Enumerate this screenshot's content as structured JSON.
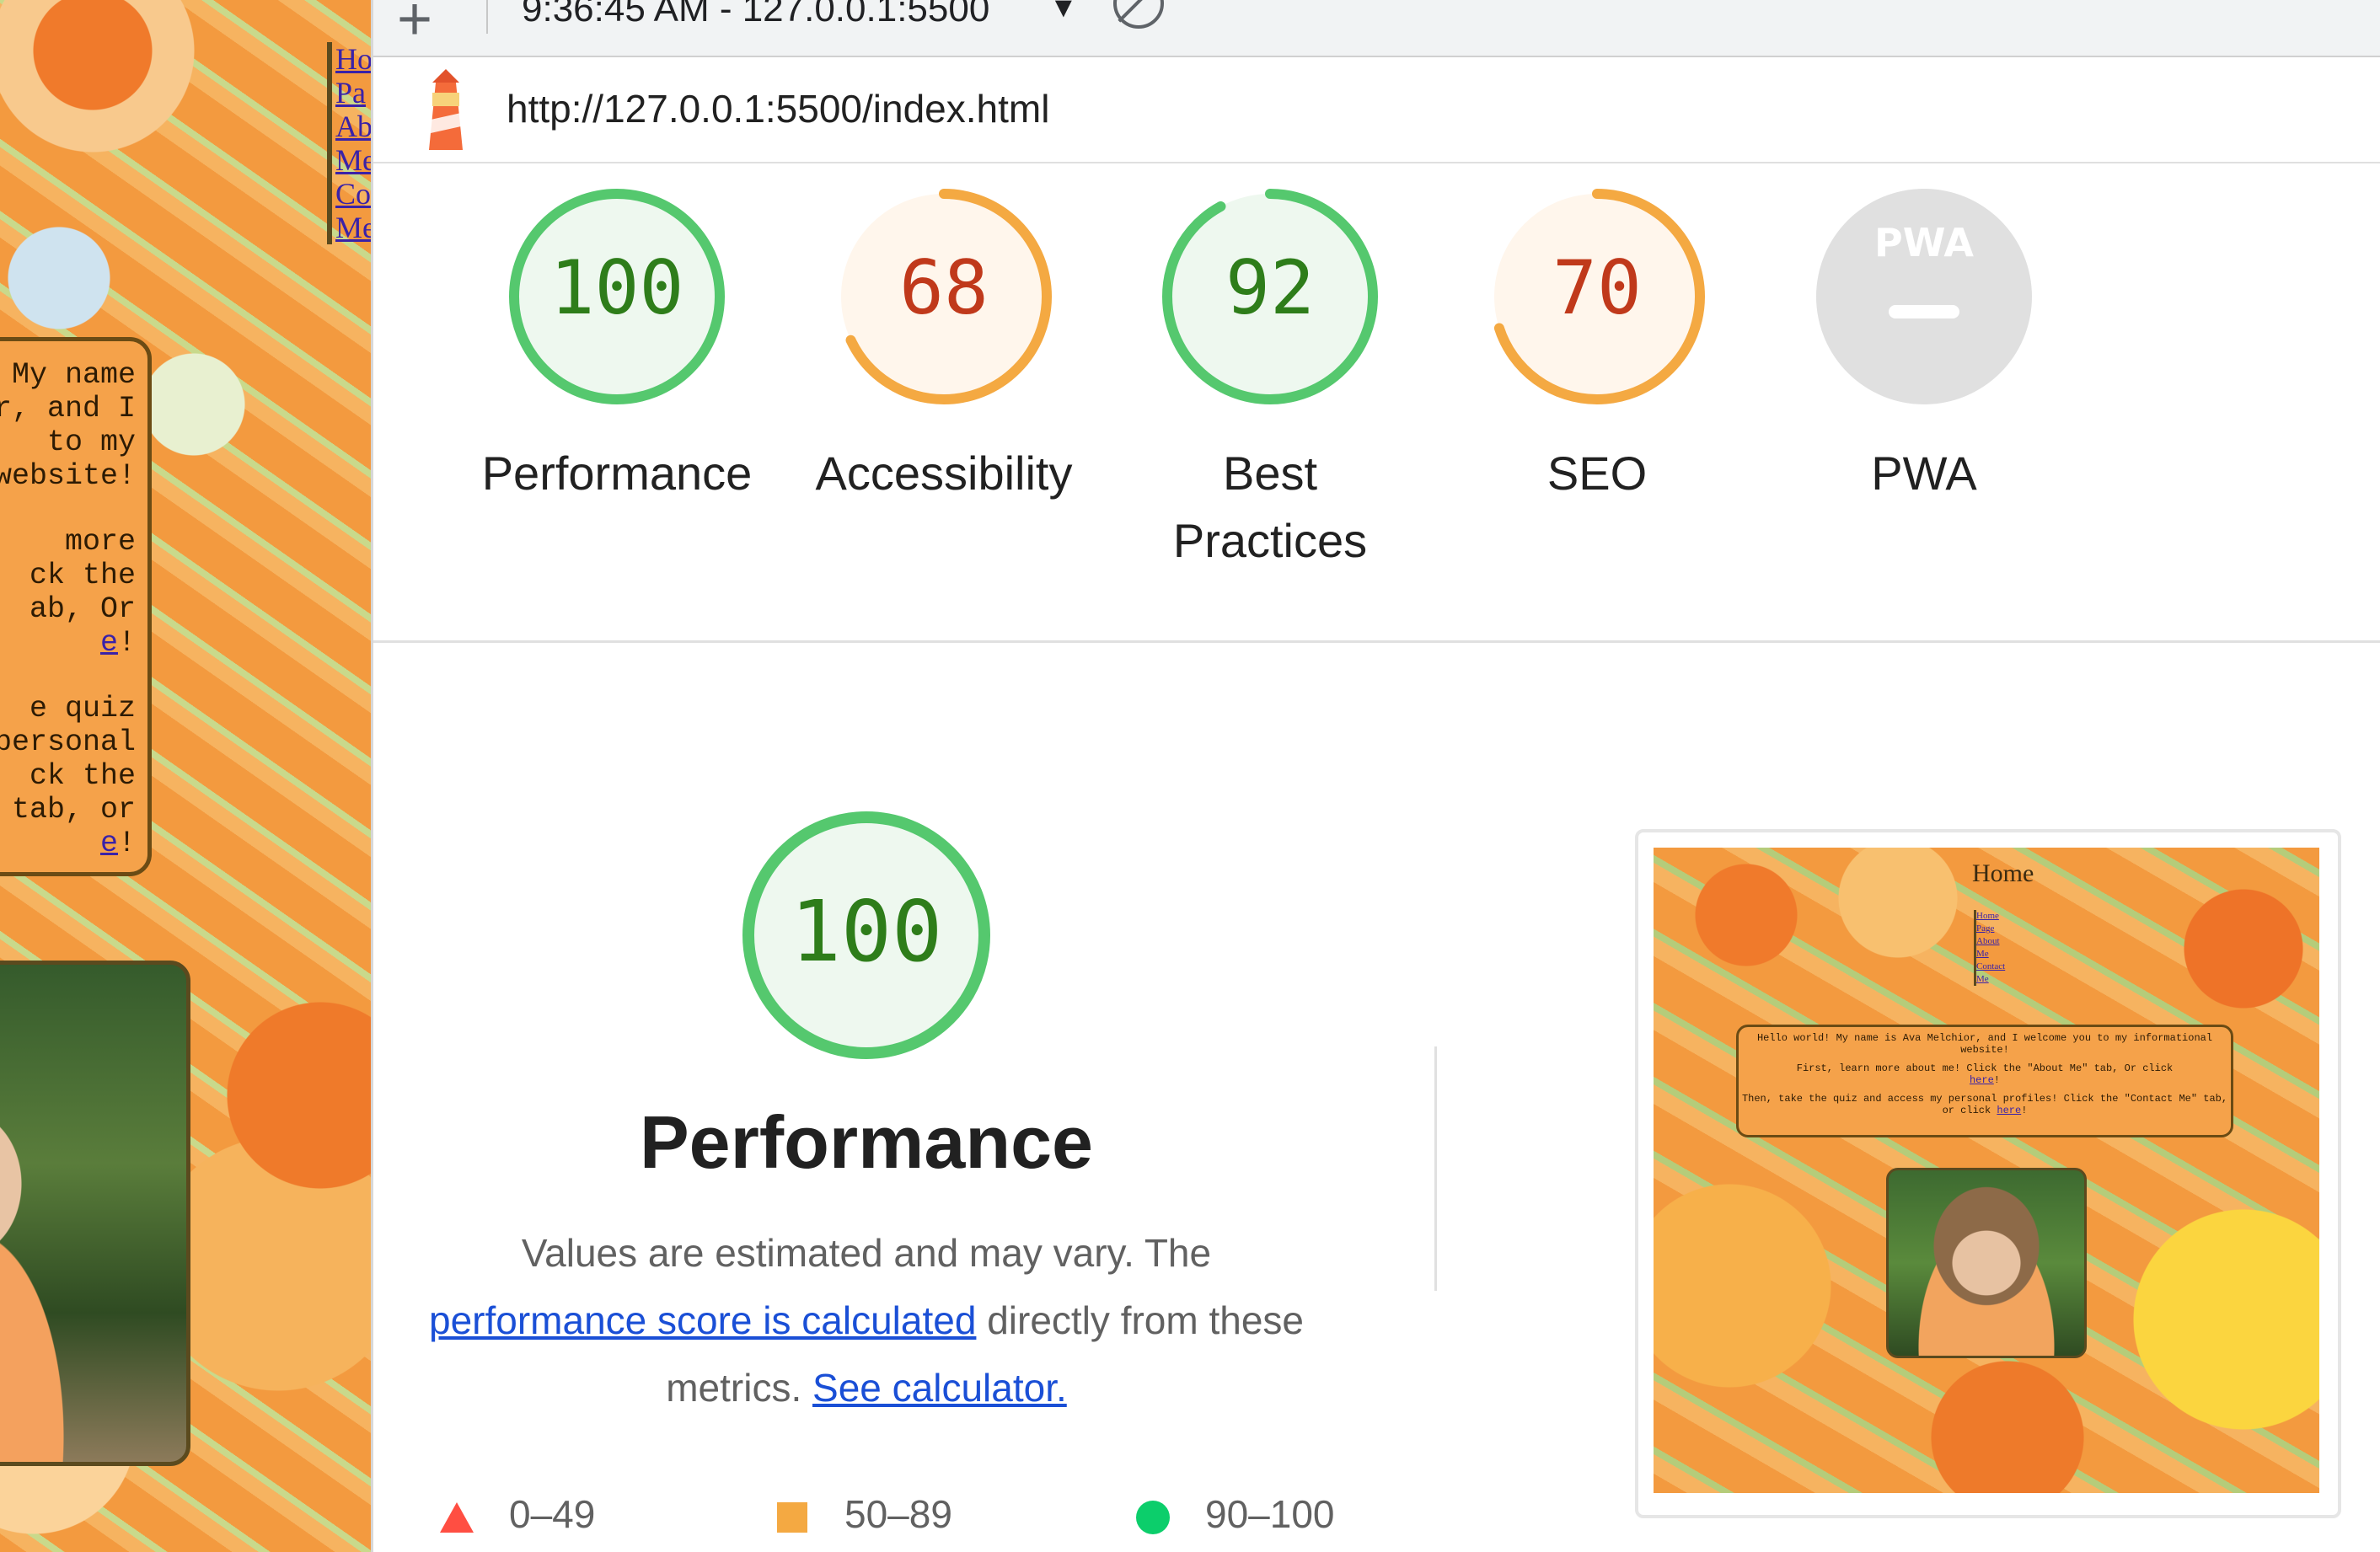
{
  "left_page": {
    "nav": [
      "Ho",
      "Pa",
      "Ab",
      "Me",
      "Co",
      "Me"
    ],
    "message_lines_1": [
      "My name",
      "r, and I",
      "to my",
      "website!"
    ],
    "message_lines_2": [
      "more",
      "ck the",
      "ab, Or"
    ],
    "message_here_1": "e",
    "message_lines_3": [
      "e quiz",
      "personal",
      "ck the",
      "tab, or"
    ],
    "message_here_2": "e"
  },
  "topbar": {
    "add_label": "+",
    "report_select": "9:36:45 AM - 127.0.0.1:5500",
    "dropdown_arrow": "▼"
  },
  "urlbar": {
    "url": "http://127.0.0.1:5500/index.html"
  },
  "colors": {
    "pass": "#0cce6b",
    "pass_ring": "#55c86e",
    "pass_text": "#2e7d1a",
    "pass_fill": "#eef8ef",
    "average": "#f4a942",
    "average_text": "#c0391b",
    "average_fill": "#fff6ec",
    "pwa_fill": "#e0e0e0",
    "link": "#1a4fd6"
  },
  "gauges": [
    {
      "label": "Performance",
      "score": "100",
      "value": 100,
      "rating": "pass"
    },
    {
      "label": "Accessibility",
      "score": "68",
      "value": 68,
      "rating": "average"
    },
    {
      "label": "Best Practices",
      "score": "92",
      "value": 92,
      "rating": "pass"
    },
    {
      "label": "SEO",
      "score": "70",
      "value": 70,
      "rating": "average"
    },
    {
      "label": "PWA",
      "score": "",
      "value": null,
      "rating": "pwa",
      "badge": "PWA"
    }
  ],
  "performance_section": {
    "score": "100",
    "title": "Performance",
    "desc_1": "Values are estimated and may vary. The",
    "link_1": "performance score is calculated",
    "desc_2": "directly from these",
    "desc_3": "metrics.",
    "link_2": "See calculator."
  },
  "legend": [
    {
      "range": "0–49",
      "shape": "triangle",
      "color": "#ff4e42"
    },
    {
      "range": "50–89",
      "shape": "square",
      "color": "#f4a942"
    },
    {
      "range": "90–100",
      "shape": "circle",
      "color": "#0cce6b"
    }
  ],
  "screenshot": {
    "heading": "Home",
    "nav": [
      "Home",
      "Page",
      "About",
      "Me",
      "Contact",
      "Me"
    ],
    "msg_1": "Hello world! My name is Ava Melchior, and I welcome you to my informational website!",
    "msg_2": "First, learn more about me! Click the \"About Me\" tab, Or click",
    "msg_3": "Then, take the quiz and access my personal profiles! Click the \"Contact Me\" tab, or click",
    "here": "here"
  }
}
